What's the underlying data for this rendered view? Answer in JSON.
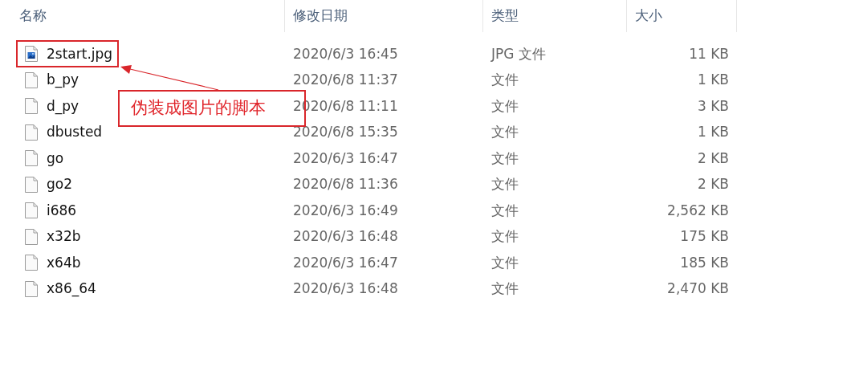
{
  "columns": [
    "名称",
    "修改日期",
    "类型",
    "大小"
  ],
  "rows": [
    {
      "kind": "image",
      "name": "2start.jpg",
      "date": "2020/6/3 16:45",
      "type": "JPG 文件",
      "size": "11 KB",
      "highlighted": true
    },
    {
      "kind": "file",
      "name": "b_py",
      "date": "2020/6/8 11:37",
      "type": "文件",
      "size": "1 KB",
      "highlighted": false
    },
    {
      "kind": "file",
      "name": "d_py",
      "date": "2020/6/8 11:11",
      "type": "文件",
      "size": "3 KB",
      "highlighted": false
    },
    {
      "kind": "file",
      "name": "dbusted",
      "date": "2020/6/8 15:35",
      "type": "文件",
      "size": "1 KB",
      "highlighted": false
    },
    {
      "kind": "file",
      "name": "go",
      "date": "2020/6/3 16:47",
      "type": "文件",
      "size": "2 KB",
      "highlighted": false
    },
    {
      "kind": "file",
      "name": "go2",
      "date": "2020/6/8 11:36",
      "type": "文件",
      "size": "2 KB",
      "highlighted": false
    },
    {
      "kind": "file",
      "name": "i686",
      "date": "2020/6/3 16:49",
      "type": "文件",
      "size": "2,562 KB",
      "highlighted": false
    },
    {
      "kind": "file",
      "name": "x32b",
      "date": "2020/6/3 16:48",
      "type": "文件",
      "size": "175 KB",
      "highlighted": false
    },
    {
      "kind": "file",
      "name": "x64b",
      "date": "2020/6/3 16:47",
      "type": "文件",
      "size": "185 KB",
      "highlighted": false
    },
    {
      "kind": "file",
      "name": "x86_64",
      "date": "2020/6/3 16:48",
      "type": "文件",
      "size": "2,470 KB",
      "highlighted": false
    }
  ],
  "annotation": {
    "text": "伪装成图片的脚本"
  }
}
